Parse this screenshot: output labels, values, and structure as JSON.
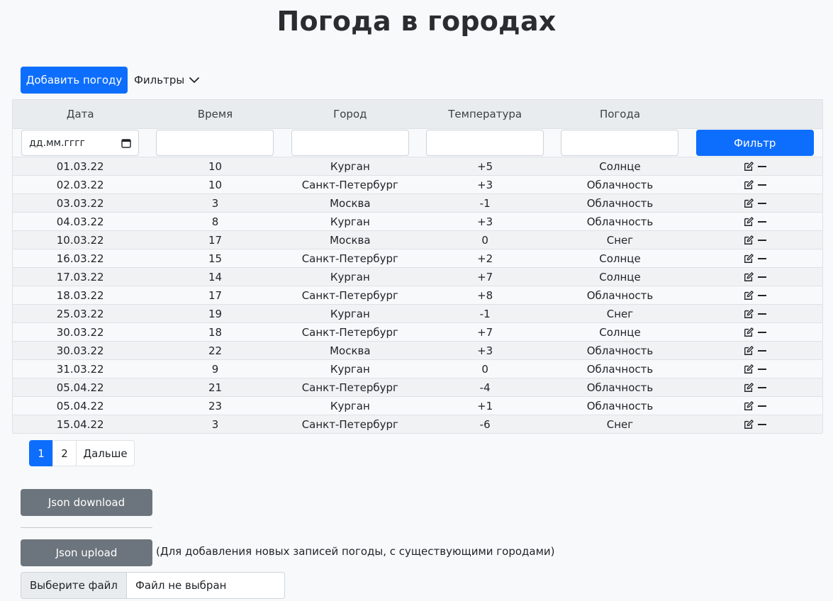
{
  "page": {
    "title": "Погода в городах"
  },
  "toolbar": {
    "add_label": "Добавить погоду",
    "filters_label": "Фильтры"
  },
  "table": {
    "headers": [
      "Дата",
      "Время",
      "Город",
      "Температура",
      "Погода",
      ""
    ],
    "filter": {
      "date_placeholder": "дд.мм.гггг",
      "button_label": "Фильтр"
    },
    "rows": [
      [
        "01.03.22",
        "10",
        "Курган",
        "+5",
        "Солнце"
      ],
      [
        "02.03.22",
        "10",
        "Санкт-Петербург",
        "+3",
        "Облачность"
      ],
      [
        "03.03.22",
        "3",
        "Москва",
        "-1",
        "Облачность"
      ],
      [
        "04.03.22",
        "8",
        "Курган",
        "+3",
        "Облачность"
      ],
      [
        "10.03.22",
        "17",
        "Москва",
        "0",
        "Снег"
      ],
      [
        "16.03.22",
        "15",
        "Санкт-Петербург",
        "+2",
        "Солнце"
      ],
      [
        "17.03.22",
        "14",
        "Курган",
        "+7",
        "Солнце"
      ],
      [
        "18.03.22",
        "17",
        "Санкт-Петербург",
        "+8",
        "Облачность"
      ],
      [
        "25.03.22",
        "19",
        "Курган",
        "-1",
        "Снег"
      ],
      [
        "30.03.22",
        "18",
        "Санкт-Петербург",
        "+7",
        "Солнце"
      ],
      [
        "30.03.22",
        "22",
        "Москва",
        "+3",
        "Облачность"
      ],
      [
        "31.03.22",
        "9",
        "Курган",
        "0",
        "Облачность"
      ],
      [
        "05.04.22",
        "21",
        "Санкт-Петербург",
        "-4",
        "Облачность"
      ],
      [
        "05.04.22",
        "23",
        "Курган",
        "+1",
        "Облачность"
      ],
      [
        "15.04.22",
        "3",
        "Санкт-Петербург",
        "-6",
        "Снег"
      ]
    ]
  },
  "pagination": {
    "pages": [
      "1",
      "2"
    ],
    "active": "1",
    "next_label": "Дальше"
  },
  "json": {
    "download_label": "Json download",
    "upload_label": "Json upload",
    "upload_note": "(Для добавления новых записей погоды, с существующими городами)"
  },
  "file": {
    "button_label": "Выберите файл",
    "status": "Файл не выбран"
  },
  "colors": {
    "primary": "#0d6efd",
    "secondary": "#6c757d"
  }
}
